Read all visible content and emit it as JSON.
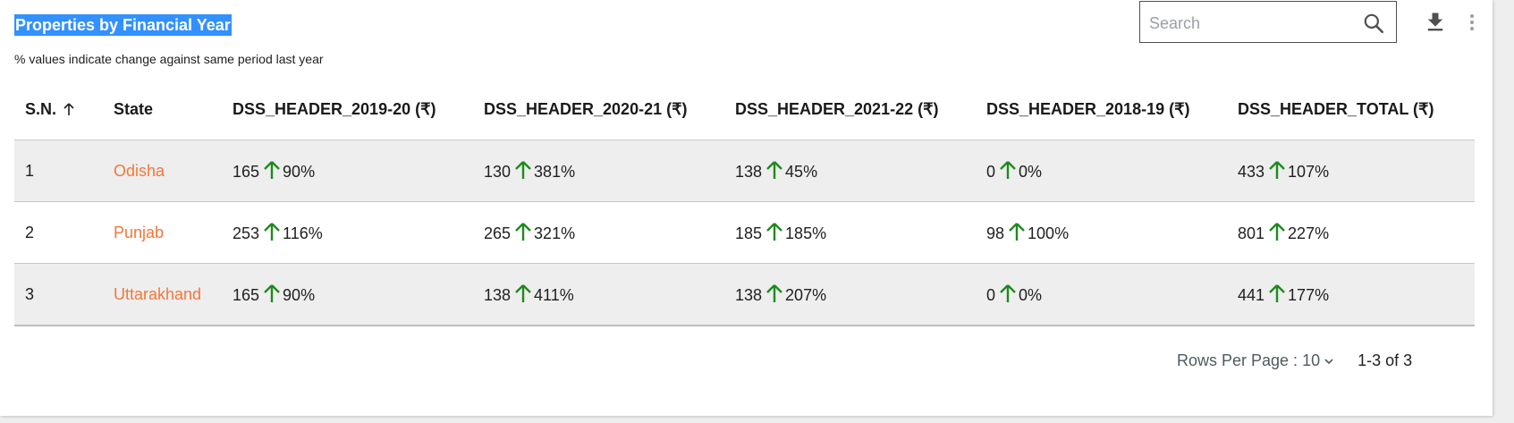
{
  "header": {
    "title": "Properties by Financial Year",
    "subtitle": "% values indicate change against same period last year"
  },
  "search": {
    "placeholder": "Search",
    "icon": "search-icon"
  },
  "toolbar": {
    "download_icon": "download-icon",
    "more_icon": "more-vertical-icon"
  },
  "table": {
    "columns": [
      "S.N.",
      "State",
      "DSS_HEADER_2019-20 (₹)",
      "DSS_HEADER_2020-21 (₹)",
      "DSS_HEADER_2021-22 (₹)",
      "DSS_HEADER_2018-19 (₹)",
      "DSS_HEADER_TOTAL (₹)"
    ],
    "rows": [
      {
        "sn": "1",
        "state": "Odisha",
        "cells": [
          {
            "value": "165",
            "pct": "90%"
          },
          {
            "value": "130",
            "pct": "381%"
          },
          {
            "value": "138",
            "pct": "45%"
          },
          {
            "value": "0",
            "pct": "0%"
          },
          {
            "value": "433",
            "pct": "107%"
          }
        ]
      },
      {
        "sn": "2",
        "state": "Punjab",
        "cells": [
          {
            "value": "253",
            "pct": "116%"
          },
          {
            "value": "265",
            "pct": "321%"
          },
          {
            "value": "185",
            "pct": "185%"
          },
          {
            "value": "98",
            "pct": "100%"
          },
          {
            "value": "801",
            "pct": "227%"
          }
        ]
      },
      {
        "sn": "3",
        "state": "Uttarakhand",
        "cells": [
          {
            "value": "165",
            "pct": "90%"
          },
          {
            "value": "138",
            "pct": "411%"
          },
          {
            "value": "138",
            "pct": "207%"
          },
          {
            "value": "0",
            "pct": "0%"
          },
          {
            "value": "441",
            "pct": "177%"
          }
        ]
      }
    ]
  },
  "pagination": {
    "rows_per_page_label": "Rows Per Page : 10",
    "range": "1-3 of 3"
  },
  "colors": {
    "link": "#f47738",
    "up_arrow": "#1e8a1e",
    "title_highlight": "#3390ff"
  }
}
